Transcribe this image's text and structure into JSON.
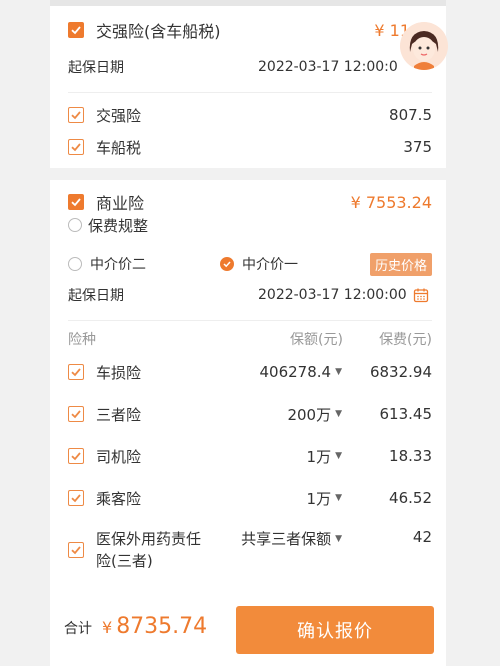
{
  "colors": {
    "accent": "#ee7a2e",
    "tag_bg": "#f0a06a",
    "button": "#f28b3b"
  },
  "card1": {
    "header_label": "交强险(含车船税)",
    "header_value": "¥ 11",
    "start_label": "起保日期",
    "start_date": "2022-03-17 12:00:0",
    "items": [
      {
        "label": "交强险",
        "value": "807.5"
      },
      {
        "label": "车船税",
        "value": "375"
      }
    ]
  },
  "card2": {
    "header_label": "商业险",
    "header_value": "¥ 7553.24",
    "adjust_label": "保费规整",
    "options": [
      {
        "label": "中介价二",
        "selected": false
      },
      {
        "label": "中介价一",
        "selected": true
      }
    ],
    "history_label": "历史价格",
    "start_label": "起保日期",
    "start_date": "2022-03-17 12:00:00",
    "columns": {
      "type": "险种",
      "amount": "保额(元)",
      "premium": "保费(元)"
    },
    "rows": [
      {
        "label": "车损险",
        "amount": "406278.4",
        "premium": "6832.94"
      },
      {
        "label": "三者险",
        "amount": "200万",
        "premium": "613.45"
      },
      {
        "label": "司机险",
        "amount": "1万",
        "premium": "18.33"
      },
      {
        "label": "乘客险",
        "amount": "1万",
        "premium": "46.52"
      },
      {
        "label": "医保外用药责任险(三者)",
        "label_line1": "医保外用药责任",
        "label_line2": "险(三者)",
        "amount": "共享三者保额",
        "premium": "42"
      }
    ]
  },
  "footer": {
    "total_label": "合计",
    "total_currency": "¥",
    "total_value": "8735.74",
    "confirm_label": "确认报价"
  },
  "icons": [
    "checkmark-icon",
    "calendar-icon",
    "dropdown-caret-icon",
    "avatar-icon"
  ]
}
